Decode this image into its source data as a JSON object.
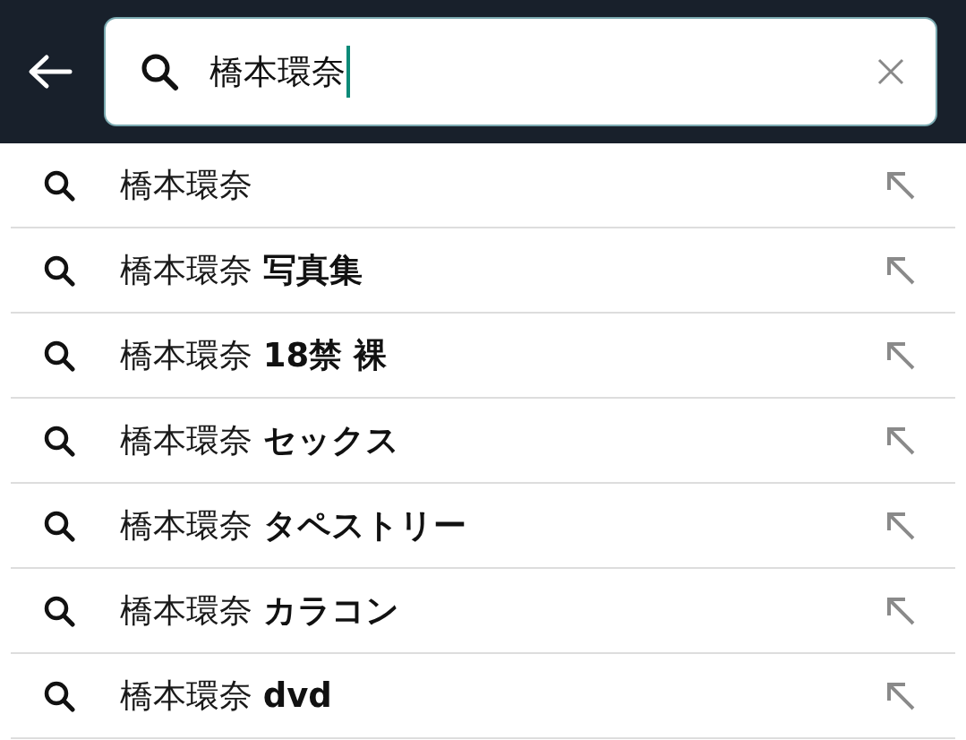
{
  "search_bar": {
    "value": "橋本環奈"
  },
  "suggestions": [
    {
      "text": "橋本環奈"
    },
    {
      "text": "橋本環奈 **写真集**"
    },
    {
      "text": "橋本環奈 **18禁 裸**"
    },
    {
      "text": "橋本環奈 **セックス**"
    },
    {
      "text": "橋本環奈 **タペストリー**"
    },
    {
      "text": "橋本環奈 **カラコン**"
    },
    {
      "text": "橋本環奈 **dvd**"
    }
  ]
}
